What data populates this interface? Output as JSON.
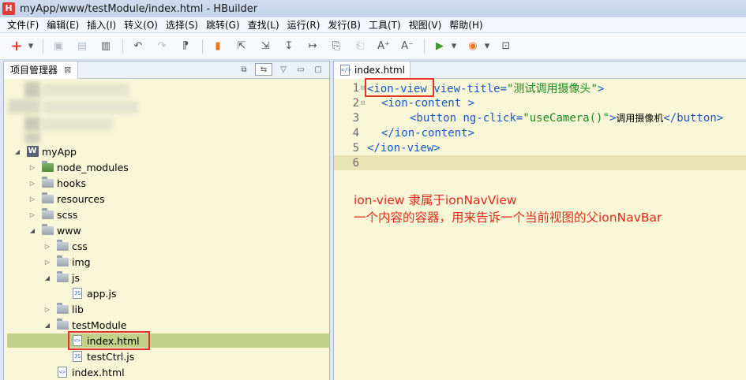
{
  "window": {
    "logo": "H",
    "title": "myApp/www/testModule/index.html  - HBuilder"
  },
  "menu": [
    "文件(F)",
    "编辑(E)",
    "插入(I)",
    "转义(O)",
    "选择(S)",
    "跳转(G)",
    "查找(L)",
    "运行(R)",
    "发行(B)",
    "工具(T)",
    "视图(V)",
    "帮助(H)"
  ],
  "toolbar": {
    "icons": [
      "new-icon",
      "dropdown-arrow-icon",
      "save-icon",
      "save-all-icon",
      "document-icon",
      "undo-icon",
      "redo-icon",
      "format-icon",
      "bookmark-icon",
      "export-icon",
      "import-icon",
      "step-in-icon",
      "step-out-icon",
      "comment-icon",
      "uncomment-icon",
      "font-increase-icon",
      "font-decrease-icon",
      "run-icon",
      "dropdown-arrow-icon",
      "chrome-browser-icon",
      "dropdown-arrow-icon",
      "help-icon"
    ]
  },
  "project_panel": {
    "tab_label": "项目管理器",
    "close": "⊠"
  },
  "tree": [
    {
      "label": "myApp",
      "depth": 0,
      "kind": "project",
      "twisty": "open"
    },
    {
      "label": "node_modules",
      "depth": 1,
      "kind": "folder-special",
      "twisty": "closed"
    },
    {
      "label": "hooks",
      "depth": 1,
      "kind": "folder",
      "twisty": "closed"
    },
    {
      "label": "resources",
      "depth": 1,
      "kind": "folder",
      "twisty": "closed"
    },
    {
      "label": "scss",
      "depth": 1,
      "kind": "folder",
      "twisty": "closed"
    },
    {
      "label": "www",
      "depth": 1,
      "kind": "folder",
      "twisty": "open"
    },
    {
      "label": "css",
      "depth": 2,
      "kind": "folder",
      "twisty": "closed"
    },
    {
      "label": "img",
      "depth": 2,
      "kind": "folder",
      "twisty": "closed"
    },
    {
      "label": "js",
      "depth": 2,
      "kind": "folder",
      "twisty": "open"
    },
    {
      "label": "app.js",
      "depth": 3,
      "kind": "file-js",
      "twisty": ""
    },
    {
      "label": "lib",
      "depth": 2,
      "kind": "folder",
      "twisty": "closed"
    },
    {
      "label": "testModule",
      "depth": 2,
      "kind": "folder",
      "twisty": "open"
    },
    {
      "label": "index.html",
      "depth": 3,
      "kind": "file-html",
      "twisty": "",
      "selected": true,
      "highlight": true
    },
    {
      "label": "testCtrl.js",
      "depth": 3,
      "kind": "file-js",
      "twisty": ""
    },
    {
      "label": "index.html",
      "depth": 2,
      "kind": "file-html",
      "twisty": ""
    }
  ],
  "editor": {
    "tab_label": "index.html",
    "lines": [
      {
        "num": "1",
        "fold": "⊟",
        "indent": 0,
        "tokens": [
          [
            "tag",
            "<ion-view"
          ],
          [
            "attr",
            " view-title="
          ],
          [
            "str",
            "\"测试调用摄像头\""
          ],
          [
            "tag",
            ">"
          ]
        ],
        "highlight": true
      },
      {
        "num": "2",
        "fold": "⊟",
        "indent": 1,
        "tokens": [
          [
            "tag",
            "<ion-content"
          ],
          [
            "tag",
            " >"
          ]
        ]
      },
      {
        "num": "3",
        "fold": "",
        "indent": 3,
        "tokens": [
          [
            "tag",
            "<button"
          ],
          [
            "attr",
            " ng-click="
          ],
          [
            "str",
            "\"useCamera()\""
          ],
          [
            "tag",
            ">"
          ],
          [
            "txt",
            "调用摄像机"
          ],
          [
            "tag",
            "</button>"
          ]
        ]
      },
      {
        "num": "4",
        "fold": "",
        "indent": 1,
        "tokens": [
          [
            "tag",
            "</ion-content>"
          ]
        ]
      },
      {
        "num": "5",
        "fold": "",
        "indent": 0,
        "tokens": [
          [
            "tag",
            "</ion-view>"
          ]
        ]
      },
      {
        "num": "6",
        "fold": "",
        "indent": 0,
        "tokens": [],
        "current": true
      }
    ]
  },
  "annotation": {
    "line1": "ion-view 隶属于ionNavView",
    "line2": "一个内容的容器，用来告诉一个当前视图的父ionNavBar"
  },
  "colors": {
    "highlight_red": "#e1352a",
    "annotation_red": "#e02a1c",
    "panel_bg": "#f7f7d7",
    "selection_bg": "#c2d08a"
  }
}
